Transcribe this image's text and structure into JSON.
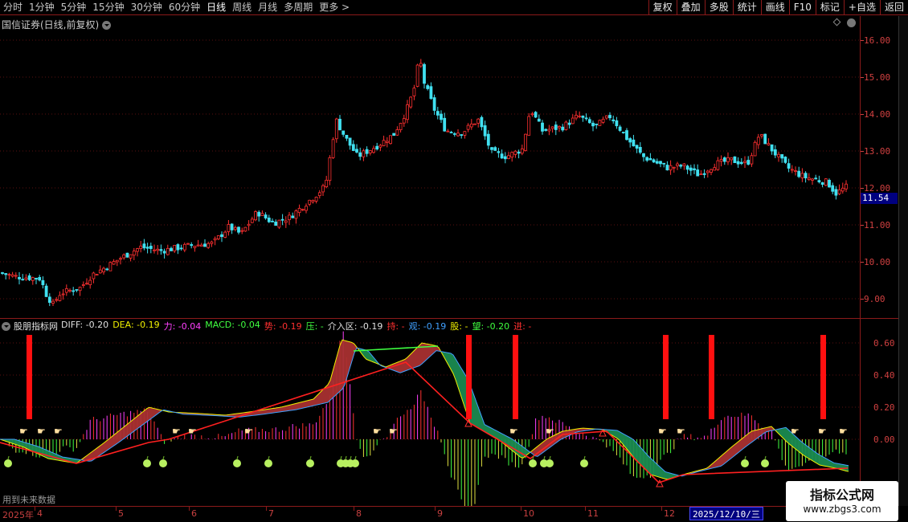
{
  "toolbar": {
    "period_tabs": [
      "分时",
      "1分钟",
      "5分钟",
      "15分钟",
      "30分钟",
      "60分钟",
      "日线",
      "周线",
      "月线",
      "多周期",
      "更多 >"
    ],
    "active_tab": "日线",
    "right_tools": [
      "复权",
      "叠加",
      "多股",
      "统计",
      "画线",
      "F10",
      "标记",
      "+自选",
      "返回"
    ]
  },
  "main_panel": {
    "stock_title": "国信证券(日线,前复权)",
    "current_price": "11.54",
    "price_axis_labels": [
      "16.00",
      "15.00",
      "14.00",
      "13.00",
      "12.00",
      "11.00",
      "10.00",
      "9.00"
    ]
  },
  "indicator_panel": {
    "name": "股朋指标网",
    "values": [
      {
        "text": "DIFF: -0.20",
        "color": "#e0e0e0"
      },
      {
        "text": "DEA: -0.19",
        "color": "#f0f000"
      },
      {
        "text": "力: -0.04",
        "color": "#ff40ff"
      },
      {
        "text": "MACD: -0.04",
        "color": "#40ff40"
      },
      {
        "text": "势: -0.19",
        "color": "#ff3030"
      },
      {
        "text": "压: -",
        "color": "#40ff40"
      },
      {
        "text": "介入区: -0.19",
        "color": "#e0e0e0"
      },
      {
        "text": "持: -",
        "color": "#ff3030"
      },
      {
        "text": "观: -0.19",
        "color": "#40a0ff"
      },
      {
        "text": "股: -",
        "color": "#f0f000"
      },
      {
        "text": "望: -0.20",
        "color": "#40ff40"
      },
      {
        "text": "进: -",
        "color": "#ff3030"
      }
    ],
    "axis_labels": [
      "0.60",
      "0.40",
      "0.20",
      "0.00"
    ],
    "footer_text": "用到未来数据"
  },
  "date_axis": {
    "year_label": "2025年",
    "months": [
      "4",
      "5",
      "6",
      "7",
      "8",
      "9",
      "10",
      "11",
      "12",
      "1"
    ],
    "cursor_date": "2025/12/10/三"
  },
  "watermark": {
    "title": "指标公式网",
    "url": "www.zbgs3.com"
  },
  "colors": {
    "up": "#ff3030",
    "down": "#40e0f0",
    "grid": "#8b1a1a",
    "accent": "#d04040"
  }
}
